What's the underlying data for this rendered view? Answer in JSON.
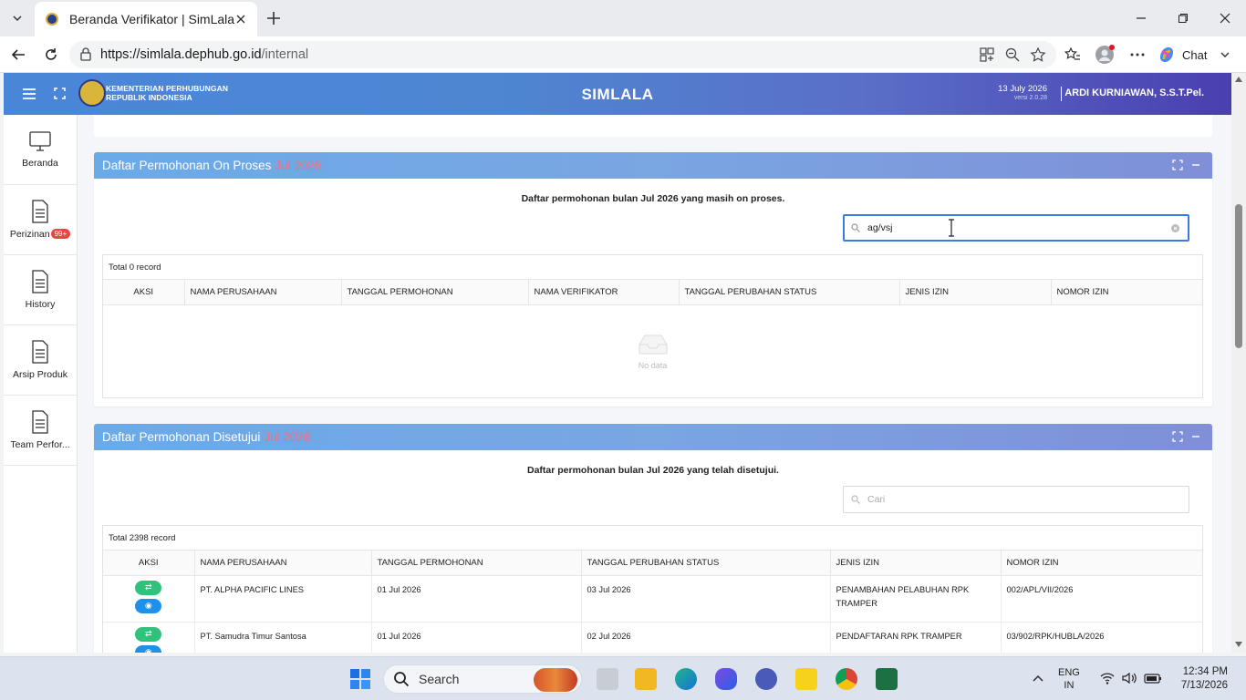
{
  "browser": {
    "tab_title": "Beranda Verifikator | SimLala",
    "url_host": "https://simlala.dephub.go.id",
    "url_path": "/internal",
    "chat_label": "Chat"
  },
  "header": {
    "ministry_line1": "KEMENTERIAN PERHUBUNGAN",
    "ministry_line2": "REPUBLIK INDONESIA",
    "app_title": "SIMLALA",
    "date": "13 July 2026",
    "version": "versi 2.0.28",
    "user": "ARDI KURNIAWAN, S.S.T.Pel."
  },
  "sidebar": {
    "items": [
      {
        "label": "Beranda",
        "icon": "monitor-icon"
      },
      {
        "label": "Perizinan",
        "icon": "document-icon",
        "badge": "99+"
      },
      {
        "label": "History",
        "icon": "document-icon"
      },
      {
        "label": "Arsip Produk",
        "icon": "document-icon"
      },
      {
        "label": "Team Perfor...",
        "icon": "document-icon"
      }
    ]
  },
  "panel_onproses": {
    "title": "Daftar Permohonan On Proses",
    "month": "Jul 2026",
    "caption": "Daftar permohonan bulan Jul 2026 yang masih on proses.",
    "search_value": "ag/vsj",
    "total": "Total 0 record",
    "columns": [
      "AKSI",
      "NAMA PERUSAHAAN",
      "TANGGAL PERMOHONAN",
      "NAMA VERIFIKATOR",
      "TANGGAL PERUBAHAN STATUS",
      "JENIS IZIN",
      "NOMOR IZIN"
    ],
    "empty_text": "No data"
  },
  "panel_disetujui": {
    "title": "Daftar Permohonan Disetujui",
    "month": "Jul 2026",
    "caption": "Daftar permohonan bulan Jul 2026 yang telah disetujui.",
    "search_placeholder": "Cari",
    "total": "Total 2398 record",
    "columns": [
      "AKSI",
      "NAMA PERUSAHAAN",
      "TANGGAL PERMOHONAN",
      "TANGGAL PERUBAHAN STATUS",
      "JENIS IZIN",
      "NOMOR IZIN"
    ],
    "rows": [
      {
        "perusahaan": "PT. ALPHA PACIFIC LINES",
        "tgl_permohonan": "01 Jul 2026",
        "tgl_status": "03 Jul 2026",
        "jenis_izin": "PENAMBAHAN PELABUHAN RPK TRAMPER",
        "nomor_izin": "002/APL/VII/2026"
      },
      {
        "perusahaan": "PT. Samudra Timur Santosa",
        "tgl_permohonan": "01 Jul 2026",
        "tgl_status": "02 Jul 2026",
        "jenis_izin": "PENDAFTARAN RPK TRAMPER",
        "nomor_izin": "03/902/RPK/HUBLA/2026"
      }
    ]
  },
  "taskbar": {
    "search_label": "Search",
    "lang1": "ENG",
    "lang2": "IN",
    "time": "12:34 PM",
    "date": "7/13/2026"
  },
  "colors": {
    "header_start": "#4a86d8",
    "header_end": "#4a3fb0",
    "month_accent": "#ff6b7a",
    "action_green": "#2fc27b",
    "action_blue": "#1e90e8",
    "badge_red": "#ef4444"
  }
}
